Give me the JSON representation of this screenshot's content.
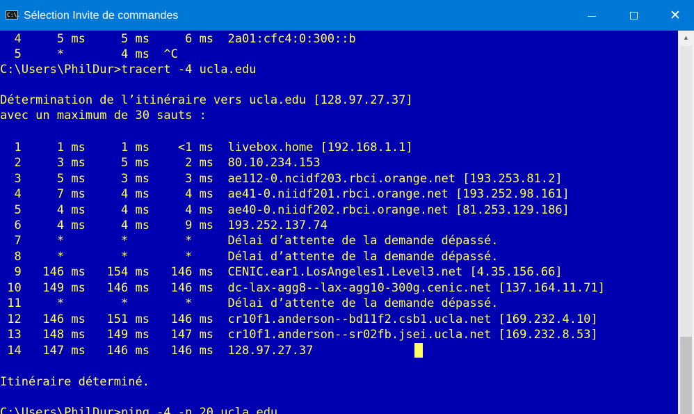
{
  "window": {
    "title": "Sélection Invite de commandes",
    "icon": "cmd-icon",
    "icon_text": "C:\\.",
    "buttons": {
      "minimize": "minimize-icon",
      "maximize": "maximize-icon",
      "close": "✕"
    }
  },
  "console": {
    "lines": [
      "  4     5 ms     5 ms     6 ms  2a01:cfc4:0:300::b",
      "  5     *        4 ms  ^C",
      "C:\\Users\\PhilDur>tracert -4 ucla.edu",
      "",
      "Détermination de l’itinéraire vers ucla.edu [128.97.27.37]",
      "avec un maximum de 30 sauts :",
      "",
      "  1     1 ms     1 ms    <1 ms  livebox.home [192.168.1.1]",
      "  2     3 ms     5 ms     2 ms  80.10.234.153",
      "  3     5 ms     3 ms     3 ms  ae112-0.ncidf203.rbci.orange.net [193.253.81.2]",
      "  4     7 ms     4 ms     4 ms  ae41-0.niidf201.rbci.orange.net [193.252.98.161]",
      "  5     4 ms     4 ms     4 ms  ae40-0.niidf202.rbci.orange.net [81.253.129.186]",
      "  6     4 ms     4 ms     9 ms  193.252.137.74",
      "  7     *        *        *     Délai d’attente de la demande dépassé.",
      "  8     *        *        *     Délai d’attente de la demande dépassé.",
      "  9   146 ms   154 ms   146 ms  CENIC.ear1.LosAngeles1.Level3.net [4.35.156.66]",
      " 10   149 ms   146 ms   146 ms  dc-lax-agg8--lax-agg10-300g.cenic.net [137.164.11.71]",
      " 11     *        *        *     Délai d’attente de la demande dépassé.",
      " 12   146 ms   151 ms   146 ms  cr10f1.anderson--bd11f2.csb1.ucla.net [169.232.4.10]",
      " 13   148 ms   149 ms   147 ms  cr10f1.anderson--sr02fb.jsei.ucla.net [169.232.8.53]",
      " 14   147 ms   146 ms   146 ms  128.97.27.37",
      "",
      "Itinéraire déterminé.",
      "",
      "C:\\Users\\PhilDur>ping -4 -n 20 ucla.edu"
    ]
  },
  "scrollbar": {
    "up_arrow": "▲"
  },
  "colors": {
    "console_background": "#0000b0",
    "console_text": "#ffff55",
    "titlebar": "#0078d7",
    "cursor": "#ffff66"
  }
}
